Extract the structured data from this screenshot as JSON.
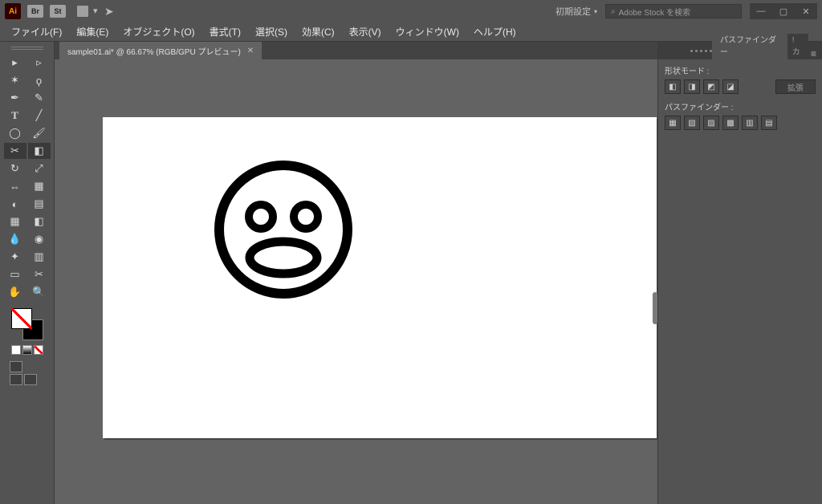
{
  "app": {
    "badge": "Ai"
  },
  "dock": {
    "br": "Br",
    "st": "St"
  },
  "workspace": {
    "label": "初期設定"
  },
  "search": {
    "placeholder": "Adobe Stock を検索"
  },
  "menu": {
    "file": "ファイル(F)",
    "edit": "編集(E)",
    "object": "オブジェクト(O)",
    "type": "書式(T)",
    "select": "選択(S)",
    "effect": "効果(C)",
    "view": "表示(V)",
    "window": "ウィンドウ(W)",
    "help": "ヘルプ(H)"
  },
  "document": {
    "tab_label": "sample01.ai* @ 66.67% (RGB/GPU プレビュー)"
  },
  "panel": {
    "tab_pathfinder": "パスファインダー",
    "tab_other": "! カ",
    "shape_modes_label": "形状モード :",
    "expand_label": "拡張",
    "pathfinders_label": "パスファインダー :"
  }
}
